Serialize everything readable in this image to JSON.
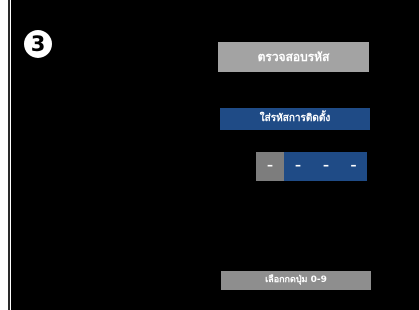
{
  "step": {
    "number": "3"
  },
  "title": "ตรวจสอบรหัส",
  "prompt": "ใส่รหัสการติดตั้ง",
  "pin": {
    "digits": [
      "–",
      "–",
      "–",
      "–"
    ],
    "active_index": 0
  },
  "hint": "เลือกกดปุ่ม 0-9",
  "colors": {
    "screen_background": "#000000",
    "title_box": "#a3a3a3",
    "prompt_bar": "#1f4b86",
    "pin_active": "#7d7d7d",
    "pin_empty": "#1f4b86",
    "hint_bar": "#8e8e8e",
    "text": "#ffffff"
  }
}
